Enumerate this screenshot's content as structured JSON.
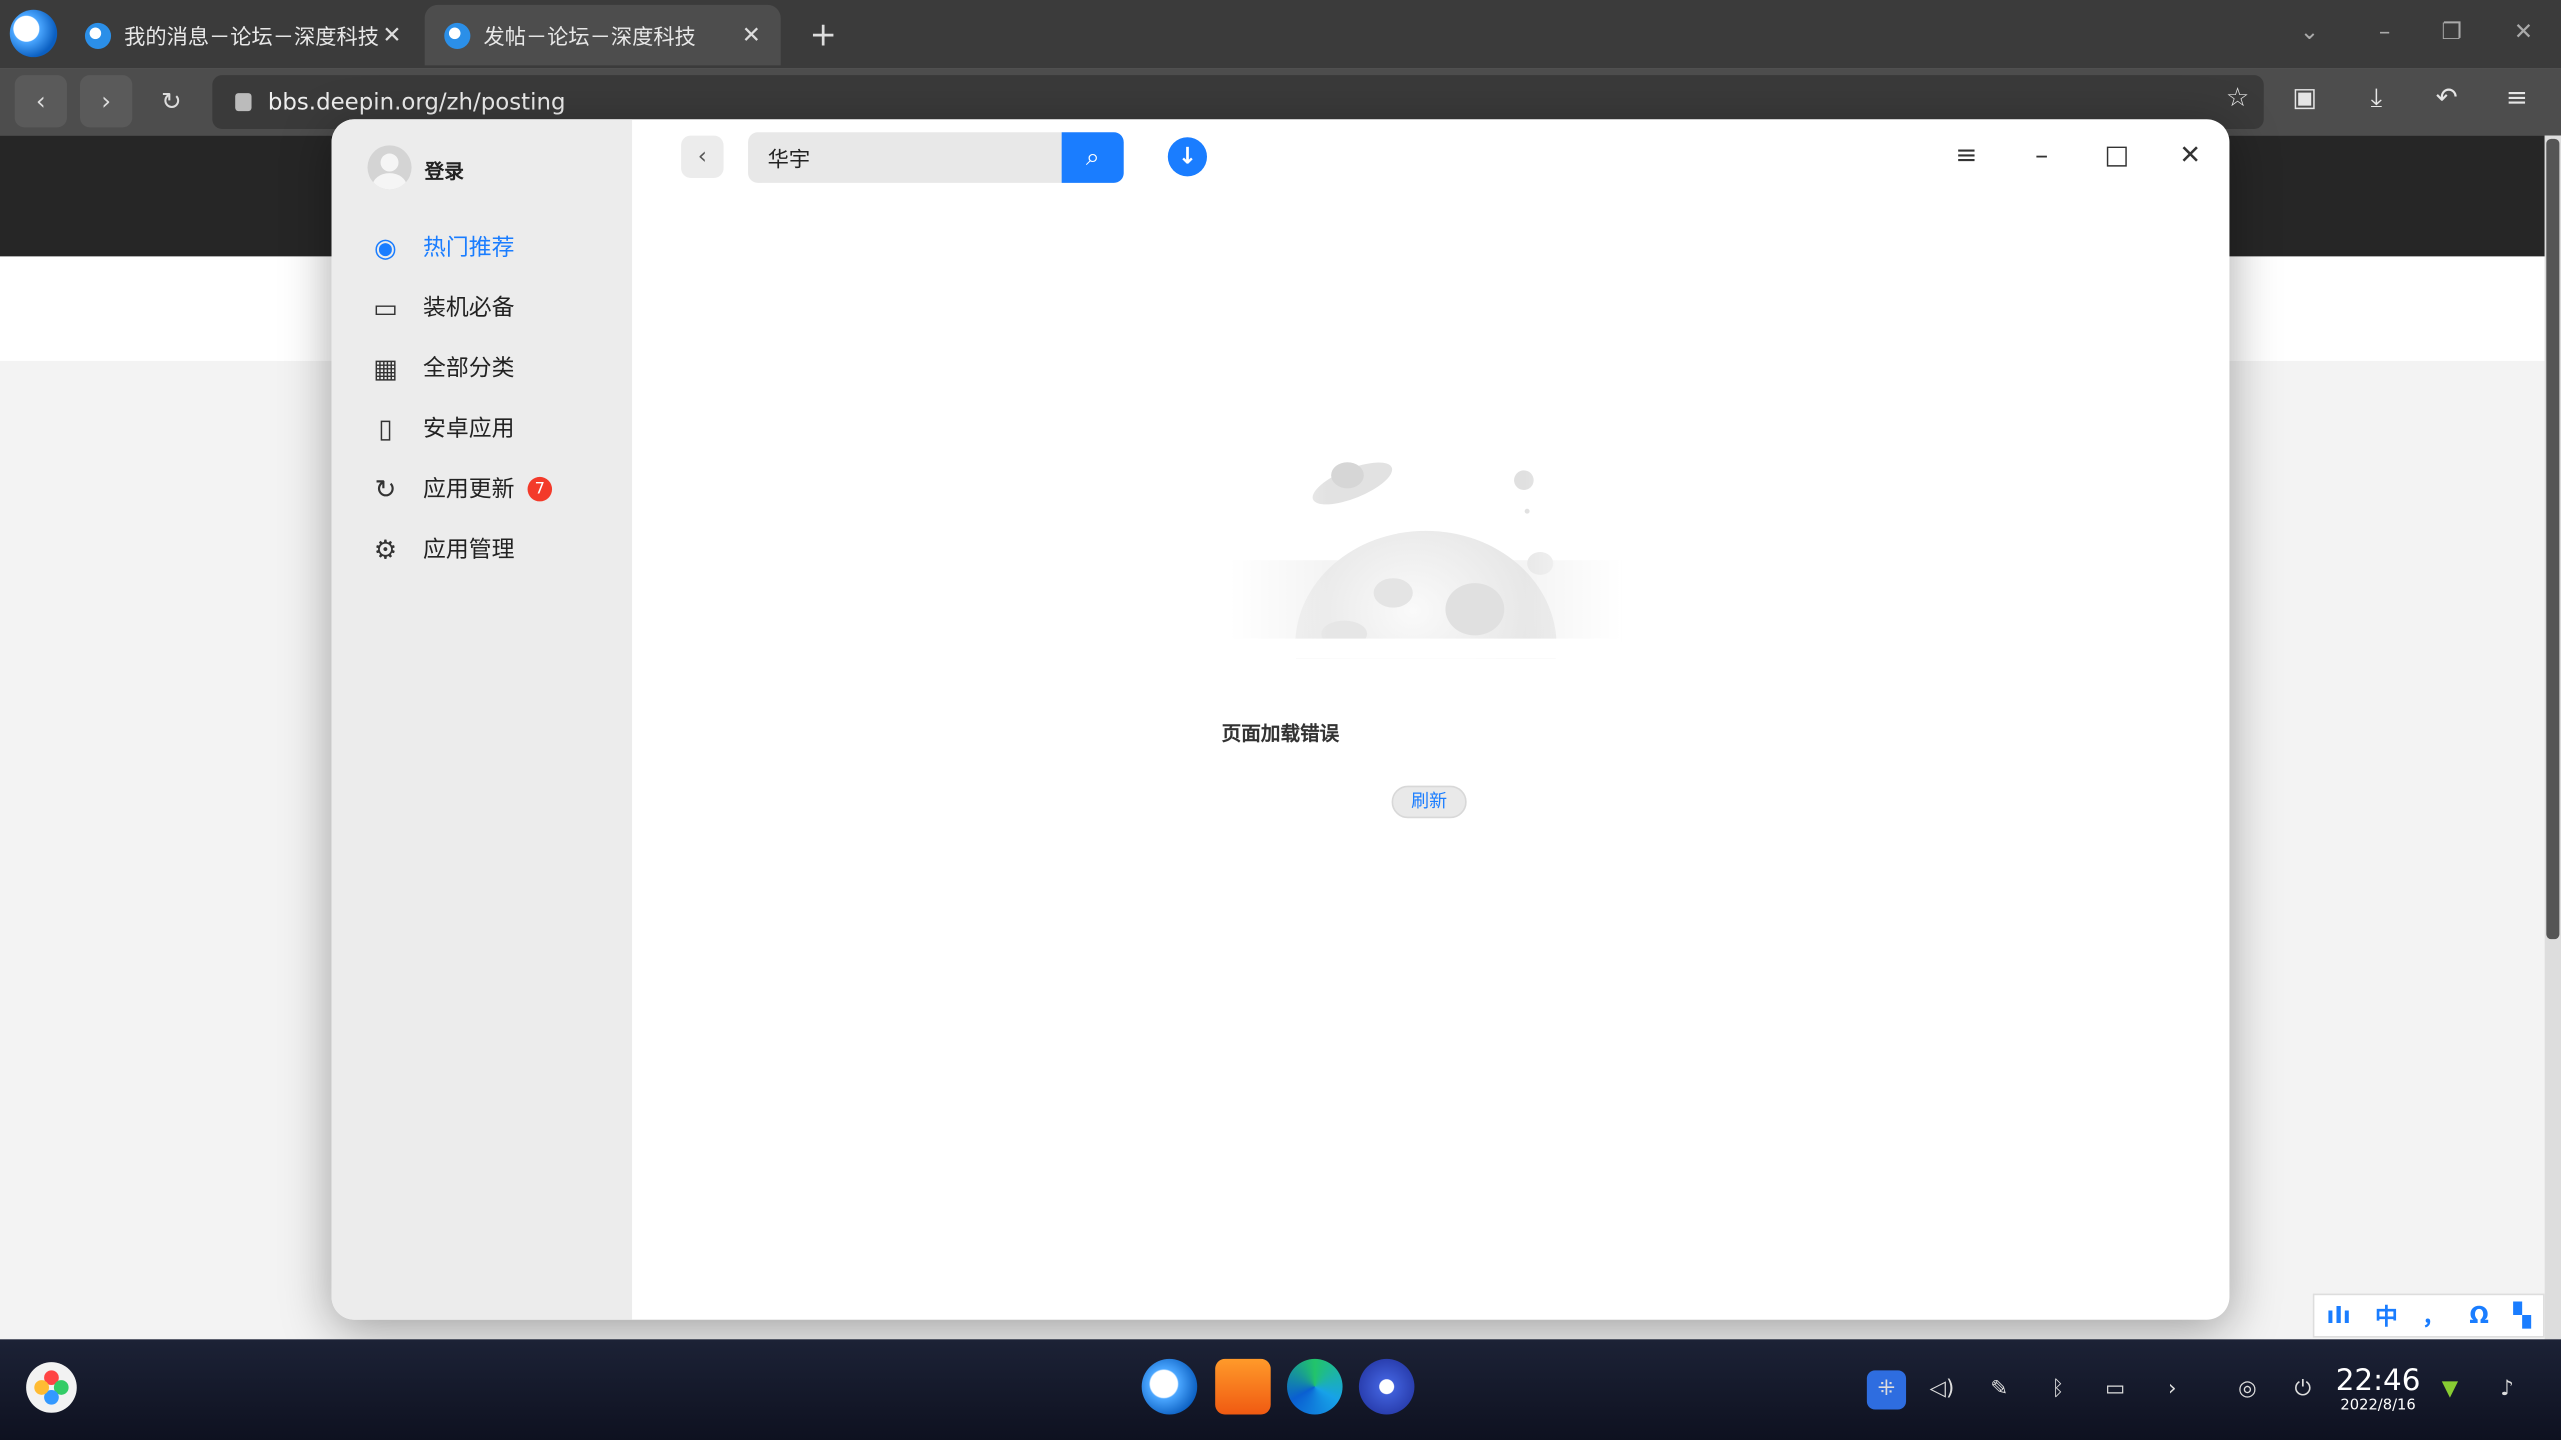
{
  "browser": {
    "tabs": [
      {
        "title": "我的消息－论坛－深度科技",
        "active": false
      },
      {
        "title": "发帖－论坛－深度科技",
        "active": true
      }
    ],
    "url": "bbs.deepin.org/zh/posting",
    "new_tab_label": "+",
    "close_label": "✕"
  },
  "app": {
    "user": {
      "login_label": "登录"
    },
    "nav": [
      {
        "label": "热门推荐",
        "icon": "flame-icon",
        "active": true
      },
      {
        "label": "装机必备",
        "icon": "monitor-icon",
        "active": false
      },
      {
        "label": "全部分类",
        "icon": "grid-icon",
        "active": false
      },
      {
        "label": "安卓应用",
        "icon": "phone-icon",
        "active": false
      },
      {
        "label": "应用更新",
        "icon": "refresh-icon",
        "active": false,
        "badge": "7"
      },
      {
        "label": "应用管理",
        "icon": "gear-icon",
        "active": false
      }
    ],
    "search": {
      "value": "华宇"
    },
    "error": {
      "message": "页面加载错误",
      "refresh_label": "刷新"
    },
    "accent": "#1a7dff"
  },
  "ime": {
    "items": [
      "中",
      "，",
      "Ω"
    ]
  },
  "taskbar": {
    "time": "22:46",
    "date": "2022/8/16"
  }
}
